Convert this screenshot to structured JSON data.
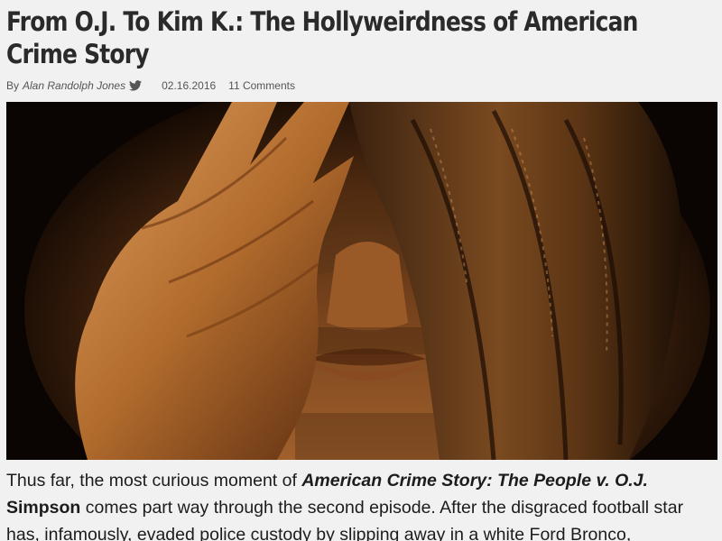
{
  "article": {
    "title": "From O.J. To Kim K.: The Hollyweirdness of American Crime Story",
    "byline": {
      "prefix": "By",
      "author": "Alan Randolph Jones",
      "share_icon": "twitter-icon",
      "date": "02.16.2016",
      "comments": "11 Comments"
    },
    "hero_image": {
      "description_icon": "hero-image"
    },
    "paragraph": {
      "part1": "Thus far, the most curious moment of ",
      "bold_italic_title": "American Crime Story: The People v. O.J.",
      "bold_name": "Simpson",
      "part2": " comes part way through the second episode. After the disgraced football star has, infamously, evaded police custody by slipping away in a white Ford Bronco,"
    }
  },
  "colors": {
    "background": "#f1f1f1",
    "title_text": "#2a2a2a",
    "meta_text": "#555555",
    "body_text": "#1c1c1c"
  }
}
